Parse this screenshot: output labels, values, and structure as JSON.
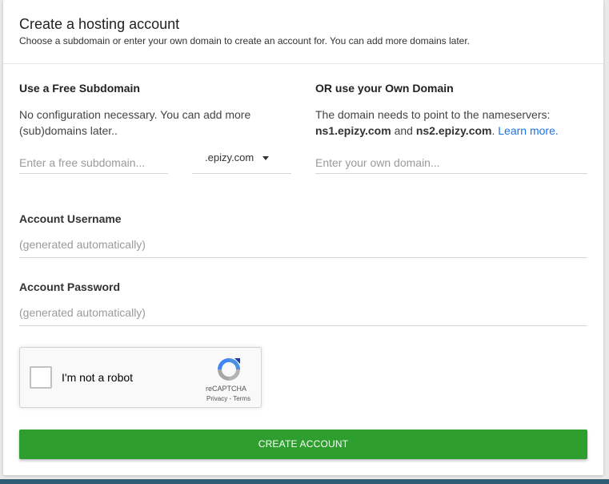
{
  "header": {
    "title": "Create a hosting account",
    "subtitle": "Choose a subdomain or enter your own domain to create an account for. You can add more domains later."
  },
  "subdomain": {
    "title": "Use a Free Subdomain",
    "description": "No configuration necessary. You can add more (sub)domains later..",
    "input_placeholder": "Enter a free subdomain...",
    "suffix_selected": ".epizy.com"
  },
  "own_domain": {
    "title": "OR use your Own Domain",
    "description_prefix": "The domain needs to point to the nameservers:",
    "ns1": "ns1.epizy.com",
    "and_text": "and",
    "ns2": "ns2.epizy.com",
    "period": ".",
    "learn_more": "Learn more.",
    "input_placeholder": "Enter your own domain..."
  },
  "username": {
    "label": "Account Username",
    "placeholder": "(generated automatically)"
  },
  "password": {
    "label": "Account Password",
    "placeholder": "(generated automatically)"
  },
  "captcha": {
    "label": "I'm not a robot",
    "brand": "reCAPTCHA",
    "terms": "Privacy - Terms",
    "icon": "recaptcha-logo-icon"
  },
  "submit": {
    "label": "CREATE ACCOUNT"
  },
  "colors": {
    "button": "#2e9e2e",
    "link": "#1a73e8",
    "bottom_strip": "#2f5d75"
  }
}
